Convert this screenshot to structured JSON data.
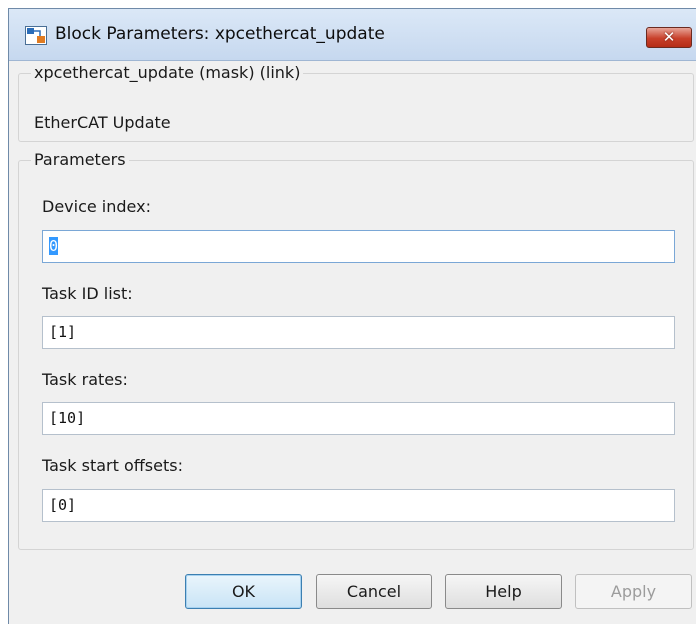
{
  "window": {
    "title": "Block Parameters: xpcethercat_update",
    "close_label": "✕"
  },
  "block": {
    "group_title": "xpcethercat_update (mask) (link)",
    "description": "EtherCAT Update"
  },
  "parameters": {
    "group_title": "Parameters",
    "fields": [
      {
        "label": "Device index:",
        "value": "0"
      },
      {
        "label": "Task ID list:",
        "value": "[1]"
      },
      {
        "label": "Task rates:",
        "value": "[10]"
      },
      {
        "label": "Task start offsets:",
        "value": "[0]"
      }
    ]
  },
  "buttons": {
    "ok": "OK",
    "cancel": "Cancel",
    "help": "Help",
    "apply": "Apply"
  },
  "colors": {
    "window_bg": "#f0f0f0",
    "close_button": "#c8402a",
    "selection": "#3399ff"
  }
}
